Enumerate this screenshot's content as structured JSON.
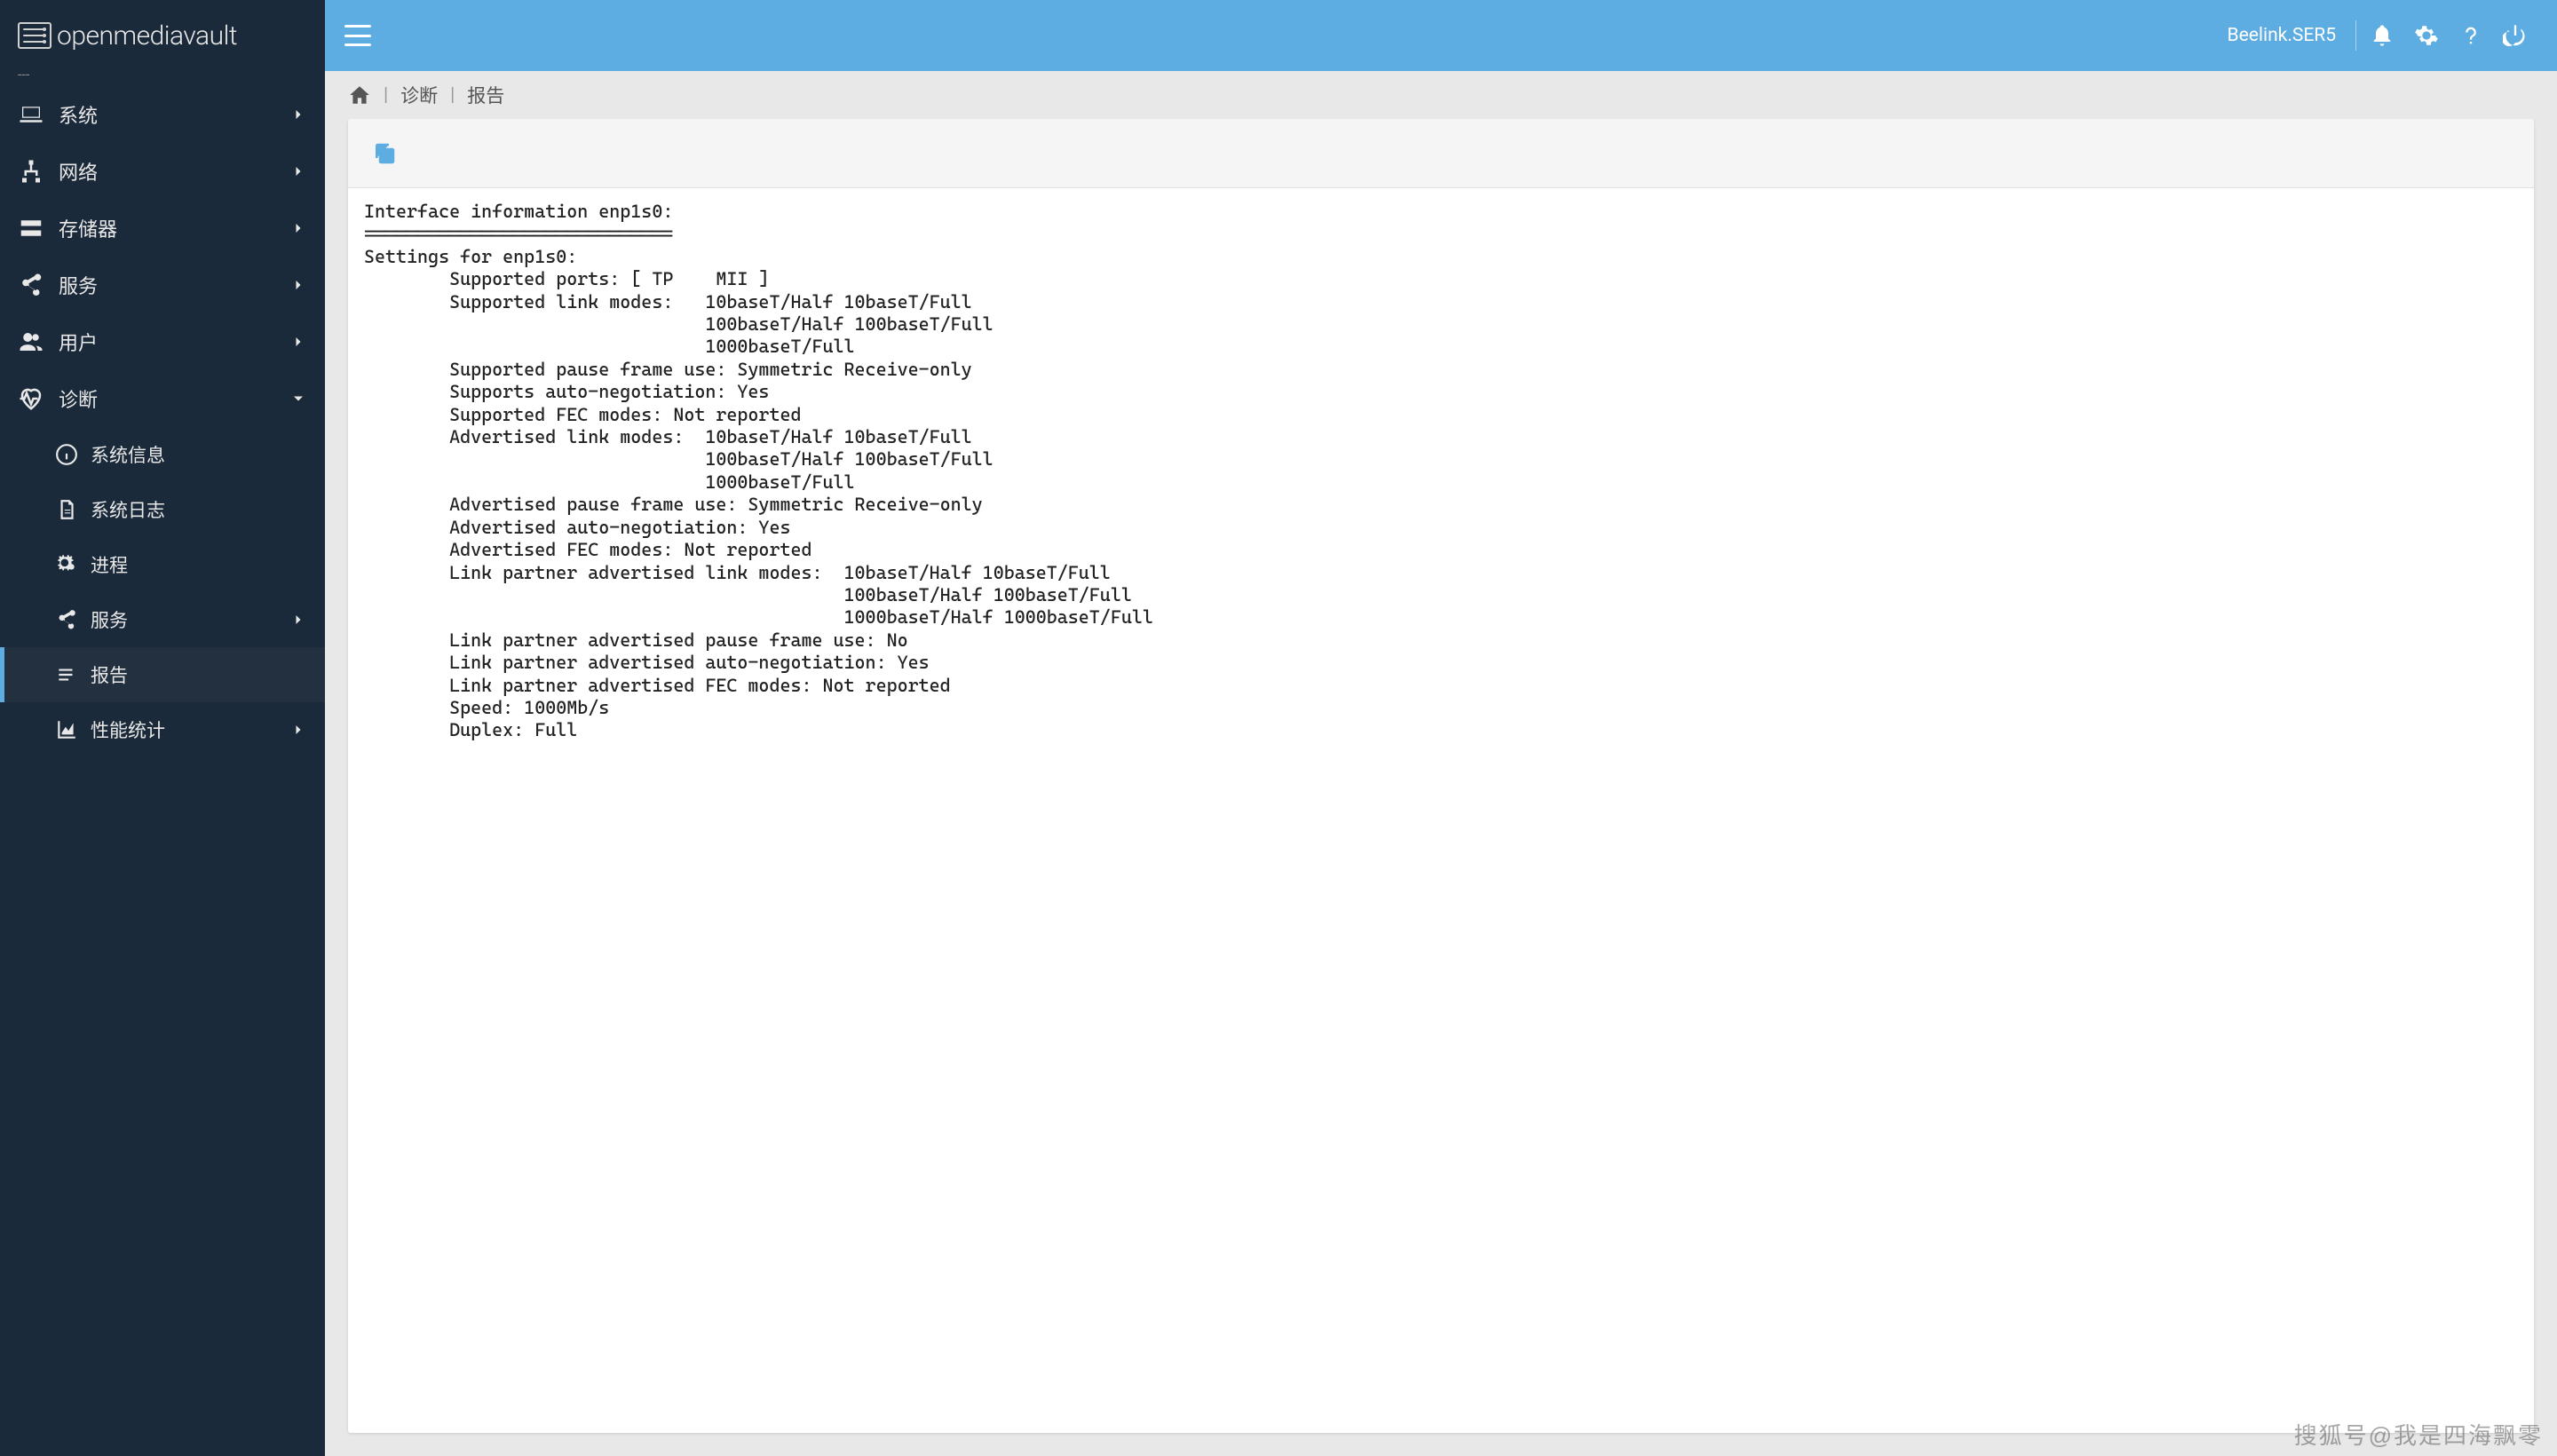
{
  "brand": "openmediavault",
  "hostname": "Beelink.SER5",
  "breadcrumb": {
    "item1": "诊断",
    "item2": "报告"
  },
  "sidebar": {
    "items": [
      {
        "label": "系统",
        "icon": "laptop",
        "expandable": true
      },
      {
        "label": "网络",
        "icon": "network",
        "expandable": true
      },
      {
        "label": "存储器",
        "icon": "storage",
        "expandable": true
      },
      {
        "label": "服务",
        "icon": "share",
        "expandable": true
      },
      {
        "label": "用户",
        "icon": "users",
        "expandable": true
      },
      {
        "label": "诊断",
        "icon": "heartbeat",
        "expanded": true
      }
    ],
    "subitems": [
      {
        "label": "系统信息",
        "icon": "info"
      },
      {
        "label": "系统日志",
        "icon": "file"
      },
      {
        "label": "进程",
        "icon": "cogs"
      },
      {
        "label": "服务",
        "icon": "share",
        "expandable": true
      },
      {
        "label": "报告",
        "icon": "notes",
        "current": true
      },
      {
        "label": "性能统计",
        "icon": "chart",
        "expandable": true
      }
    ]
  },
  "report_text": "Interface information enp1s0:\n=============================\nSettings for enp1s0:\n        Supported ports: [ TP    MII ]\n        Supported link modes:   10baseT/Half 10baseT/Full\n                                100baseT/Half 100baseT/Full\n                                1000baseT/Full\n        Supported pause frame use: Symmetric Receive-only\n        Supports auto-negotiation: Yes\n        Supported FEC modes: Not reported\n        Advertised link modes:  10baseT/Half 10baseT/Full\n                                100baseT/Half 100baseT/Full\n                                1000baseT/Full\n        Advertised pause frame use: Symmetric Receive-only\n        Advertised auto-negotiation: Yes\n        Advertised FEC modes: Not reported\n        Link partner advertised link modes:  10baseT/Half 10baseT/Full\n                                             100baseT/Half 100baseT/Full\n                                             1000baseT/Half 1000baseT/Full\n        Link partner advertised pause frame use: No\n        Link partner advertised auto-negotiation: Yes\n        Link partner advertised FEC modes: Not reported\n        Speed: 1000Mb/s\n        Duplex: Full",
  "watermark": "搜狐号@我是四海飘零"
}
